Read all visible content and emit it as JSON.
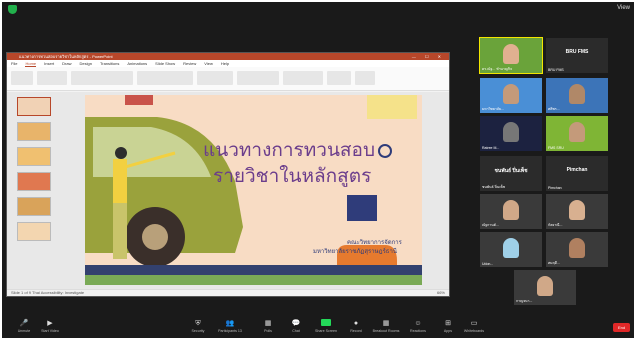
{
  "top": {
    "view_label": "View"
  },
  "ppt": {
    "window_title": "แนวทางการทวนสอบรายวิชาในหลักสูตร - PowerPoint",
    "window_controls": "— ☐ ✕",
    "menu": [
      "File",
      "Home",
      "Insert",
      "Draw",
      "Design",
      "Transitions",
      "Animations",
      "Slide Show",
      "Review",
      "View",
      "Help"
    ],
    "status_left": "Slide 1 of 9  Thai  Accessibility: Investigate",
    "zoom": "66%"
  },
  "slide": {
    "title_line1": "แนวทางการทวนสอบ",
    "title_line2": "รายวิชาในหลักสูตร",
    "subtitle1": "คณะวิทยาการจัดการ",
    "subtitle2": "มหาวิทยาลัยราชภัฏสุราษฎร์ธานี"
  },
  "participants": [
    {
      "name": "ดร.ณัฐ...  ชำนาญกิจ",
      "type": "video",
      "bg": "#6aa33a",
      "face": "#e0b090",
      "speaking": true
    },
    {
      "name": "BRU FMS",
      "type": "text",
      "big": "BRU FMS"
    },
    {
      "name": "มหาวิทยาลัย...",
      "type": "video",
      "bg": "#4a8fd6",
      "face": "#c49a7a"
    },
    {
      "name": "ศศิพร...",
      "type": "video",
      "bg": "#3c74b8",
      "face": "#b08868"
    },
    {
      "name": "Ratree M...",
      "type": "video",
      "bg": "#1c2240",
      "face": "#777777"
    },
    {
      "name": "FMS SRU",
      "type": "video",
      "bg": "#7fb535",
      "face": "#c49a7a"
    },
    {
      "name": "ชนพันธ์ ปิ่นเพ็ช",
      "type": "text",
      "big": "ชนพันธ์ ปิ่นเพ็ช"
    },
    {
      "name": "Pimchan",
      "type": "text",
      "big": "Pimchan"
    },
    {
      "name": "ณัฐกานต์...",
      "type": "video",
      "bg": "#3a3a3a",
      "face": "#d0a888"
    },
    {
      "name": "กัลยาณี...",
      "type": "video",
      "bg": "#3a3a3a",
      "face": "#d8b090"
    },
    {
      "name": "Udon...",
      "type": "video",
      "bg": "#3a3a3a",
      "face": "#9fd0e8"
    },
    {
      "name": "สมฤดี...",
      "type": "video",
      "bg": "#3a3a3a",
      "face": "#b08060"
    },
    {
      "name": "กาญจนา...",
      "type": "video",
      "bg": "#3a3a3a",
      "face": "#d0a888"
    }
  ],
  "toolbar": {
    "buttons": [
      {
        "label": "Unmute",
        "icon": "🎤"
      },
      {
        "label": "Start Video",
        "icon": "▶"
      },
      {
        "label": "Security",
        "icon": "⛨"
      },
      {
        "label": "Participants 13",
        "icon": "👥"
      },
      {
        "label": "Polls",
        "icon": "▦"
      },
      {
        "label": "Chat",
        "icon": "💬"
      },
      {
        "label": "Share Screen",
        "icon": ""
      },
      {
        "label": "Record",
        "icon": "●"
      },
      {
        "label": "Breakout Rooms",
        "icon": "▦"
      },
      {
        "label": "Reactions",
        "icon": "☺"
      },
      {
        "label": "Apps",
        "icon": "⊞"
      },
      {
        "label": "Whiteboards",
        "icon": "▭"
      }
    ],
    "end_label": "End"
  },
  "colors": {
    "accent": "#23d959",
    "end": "#e02828",
    "speaker_outline": "#f2e600",
    "ppt_brand": "#b7472a"
  }
}
